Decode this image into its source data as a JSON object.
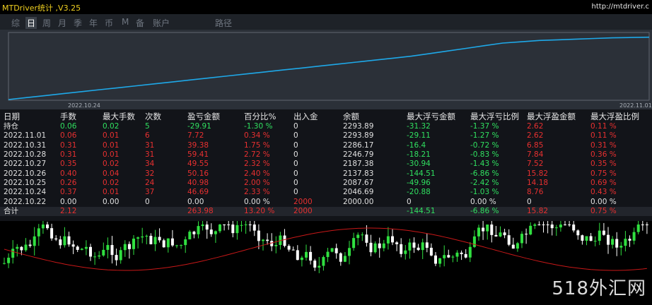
{
  "app": {
    "title": "MTDriver统计 ,V3.25",
    "url": "http://mtdriver.c"
  },
  "tabs": [
    {
      "label": "综",
      "active": false
    },
    {
      "label": "日",
      "active": true
    },
    {
      "label": "周",
      "active": false
    },
    {
      "label": "月",
      "active": false
    },
    {
      "label": "季",
      "active": false
    },
    {
      "label": "年",
      "active": false
    },
    {
      "label": "币",
      "active": false
    },
    {
      "label": "M",
      "active": false
    },
    {
      "label": "备",
      "active": false
    },
    {
      "label": "账户",
      "active": false
    },
    {
      "label": "路径",
      "active": false
    }
  ],
  "equity_chart": {
    "start_label": "2022.10.24",
    "end_label": "2022.11.01",
    "line_color": "#1ea8e8",
    "values": [
      0,
      3,
      6,
      9,
      12,
      15,
      18,
      21,
      24,
      27,
      30,
      33,
      36,
      39,
      42,
      45,
      48,
      51,
      54,
      57,
      60,
      63,
      66,
      70,
      74,
      78,
      82,
      86,
      88,
      90,
      91,
      92,
      93,
      94,
      94.5,
      95
    ],
    "ylim": [
      0,
      100
    ]
  },
  "stats": {
    "headers": [
      "日期",
      "手数",
      "最大手数",
      "次数",
      "盈亏金额",
      "百分比%",
      "出入金",
      "余额",
      "最大浮亏金额",
      "最大浮亏比例",
      "最大浮盈金额",
      "最大浮盈比例"
    ],
    "rows": [
      {
        "cells": [
          "持仓",
          "0.06",
          "0.02",
          "5",
          "-29.91",
          "-1.30 %",
          "0",
          "2293.89",
          "-31.32",
          "-1.37 %",
          "2.62",
          "0.11 %"
        ],
        "colors": [
          "wht",
          "grn",
          "grn",
          "grn",
          "grn",
          "grn",
          "wht",
          "wht",
          "grn",
          "grn",
          "red",
          "red"
        ]
      },
      {
        "cells": [
          "2022.11.01",
          "0.06",
          "0.01",
          "6",
          "7.72",
          "0.34 %",
          "0",
          "2293.89",
          "-29.11",
          "-1.27 %",
          "2.62",
          "0.11 %"
        ],
        "colors": [
          "wht",
          "red",
          "red",
          "red",
          "red",
          "red",
          "wht",
          "wht",
          "grn",
          "grn",
          "red",
          "red"
        ]
      },
      {
        "cells": [
          "2022.10.31",
          "0.31",
          "0.01",
          "31",
          "39.38",
          "1.75 %",
          "0",
          "2286.17",
          "-16.4",
          "-0.72 %",
          "6.85",
          "0.31 %"
        ],
        "colors": [
          "wht",
          "red",
          "red",
          "red",
          "red",
          "red",
          "wht",
          "wht",
          "grn",
          "grn",
          "red",
          "red"
        ]
      },
      {
        "cells": [
          "2022.10.28",
          "0.31",
          "0.01",
          "31",
          "59.41",
          "2.72 %",
          "0",
          "2246.79",
          "-18.21",
          "-0.83 %",
          "7.84",
          "0.36 %"
        ],
        "colors": [
          "wht",
          "red",
          "red",
          "red",
          "red",
          "red",
          "wht",
          "wht",
          "grn",
          "grn",
          "red",
          "red"
        ]
      },
      {
        "cells": [
          "2022.10.27",
          "0.35",
          "0.02",
          "34",
          "49.55",
          "2.32 %",
          "0",
          "2187.38",
          "-30.94",
          "-1.43 %",
          "7.52",
          "0.35 %"
        ],
        "colors": [
          "wht",
          "red",
          "red",
          "red",
          "red",
          "red",
          "wht",
          "wht",
          "grn",
          "grn",
          "red",
          "red"
        ]
      },
      {
        "cells": [
          "2022.10.26",
          "0.40",
          "0.04",
          "32",
          "50.16",
          "2.40 %",
          "0",
          "2137.83",
          "-144.51",
          "-6.86 %",
          "15.82",
          "0.75 %"
        ],
        "colors": [
          "wht",
          "red",
          "red",
          "red",
          "red",
          "red",
          "wht",
          "wht",
          "grn",
          "grn",
          "red",
          "red"
        ]
      },
      {
        "cells": [
          "2022.10.25",
          "0.26",
          "0.02",
          "24",
          "40.98",
          "2.00 %",
          "0",
          "2087.67",
          "-49.96",
          "-2.42 %",
          "14.18",
          "0.69 %"
        ],
        "colors": [
          "wht",
          "red",
          "red",
          "red",
          "red",
          "red",
          "wht",
          "wht",
          "grn",
          "grn",
          "red",
          "red"
        ]
      },
      {
        "cells": [
          "2022.10.24",
          "0.37",
          "0.01",
          "37",
          "46.69",
          "2.33 %",
          "0",
          "2046.69",
          "-20.88",
          "-1.03 %",
          "8.76",
          "0.43 %"
        ],
        "colors": [
          "wht",
          "red",
          "red",
          "red",
          "red",
          "red",
          "wht",
          "wht",
          "grn",
          "grn",
          "red",
          "red"
        ]
      },
      {
        "cells": [
          "2022.10.22",
          "0.00",
          "0.00",
          "0",
          "0.00",
          "0.00 %",
          "2000",
          "2000.00",
          "0",
          "0.00 %",
          "0",
          "0.00 %"
        ],
        "colors": [
          "wht",
          "wht",
          "wht",
          "wht",
          "wht",
          "wht",
          "red",
          "wht",
          "wht",
          "wht",
          "wht",
          "wht"
        ]
      },
      {
        "cells": [
          "合计",
          "2.12",
          "",
          "",
          "263.98",
          "13.20 %",
          "2000",
          "",
          "-144.51",
          "-6.86 %",
          "15.82",
          "0.75 %"
        ],
        "colors": [
          "wht",
          "red",
          "wht",
          "wht",
          "red",
          "red",
          "red",
          "wht",
          "grn",
          "grn",
          "red",
          "red"
        ]
      }
    ]
  },
  "candles": {
    "up_color": "#30e040",
    "down_color": "#ffffff",
    "ma_color": "#c81818"
  },
  "watermark": "518外汇网"
}
